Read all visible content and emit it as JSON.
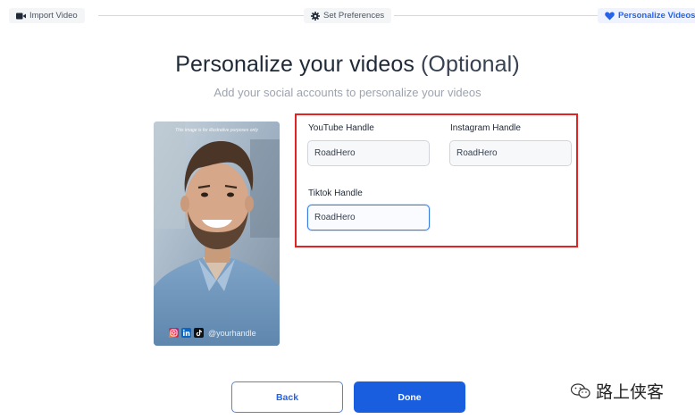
{
  "stepper": {
    "steps": [
      {
        "label": "Import Video",
        "icon": "video-camera-icon",
        "state": "done"
      },
      {
        "label": "Set Preferences",
        "icon": "gear-icon",
        "state": "done"
      },
      {
        "label": "Personalize Videos",
        "icon": "heart-icon",
        "state": "active"
      }
    ],
    "active_color": "#2563eb"
  },
  "header": {
    "title": "Personalize your videos",
    "title_suffix": "(Optional)",
    "subtitle": "Add your social accounts to personalize your videos"
  },
  "preview": {
    "disclaimer": "This image is for illustrative purposes only",
    "handle": "@yourhandle",
    "social_icons": [
      "instagram-icon",
      "linkedin-icon",
      "tiktok-icon"
    ]
  },
  "form": {
    "highlight_color": "#e02424",
    "youtube": {
      "label": "YouTube Handle",
      "value": "RoadHero"
    },
    "instagram": {
      "label": "Instagram Handle",
      "value": "RoadHero"
    },
    "tiktok": {
      "label": "Tiktok Handle",
      "value": "RoadHero",
      "focused": true
    }
  },
  "actions": {
    "back_label": "Back",
    "done_label": "Done",
    "primary_color": "#1a5ee0"
  },
  "watermark": {
    "text": "路上侠客"
  }
}
